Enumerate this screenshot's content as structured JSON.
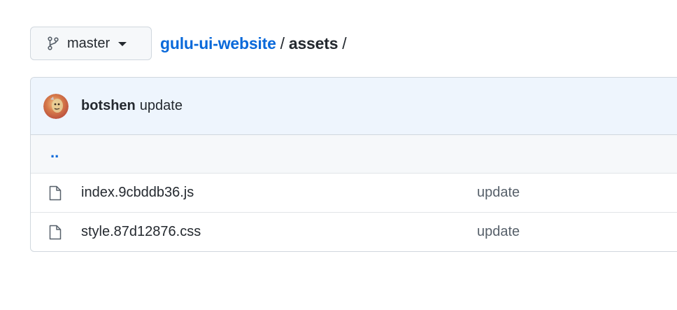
{
  "branch": {
    "name": "master",
    "icon": "git-branch-icon"
  },
  "breadcrumb": {
    "repo": "gulu-ui-website",
    "separator": "/",
    "current": "assets",
    "trailing": "/"
  },
  "latest_commit": {
    "author": "botshen",
    "message": "update",
    "avatar_icon": "avatar"
  },
  "parent_dir_label": "..",
  "files": [
    {
      "name": "index.9cbddb36.js",
      "commit_message": "update",
      "icon": "file-icon"
    },
    {
      "name": "style.87d12876.css",
      "commit_message": "update",
      "icon": "file-icon"
    }
  ],
  "colors": {
    "link": "#0969da",
    "commit_bar": "#eef5fd",
    "border": "#d0d7de"
  }
}
